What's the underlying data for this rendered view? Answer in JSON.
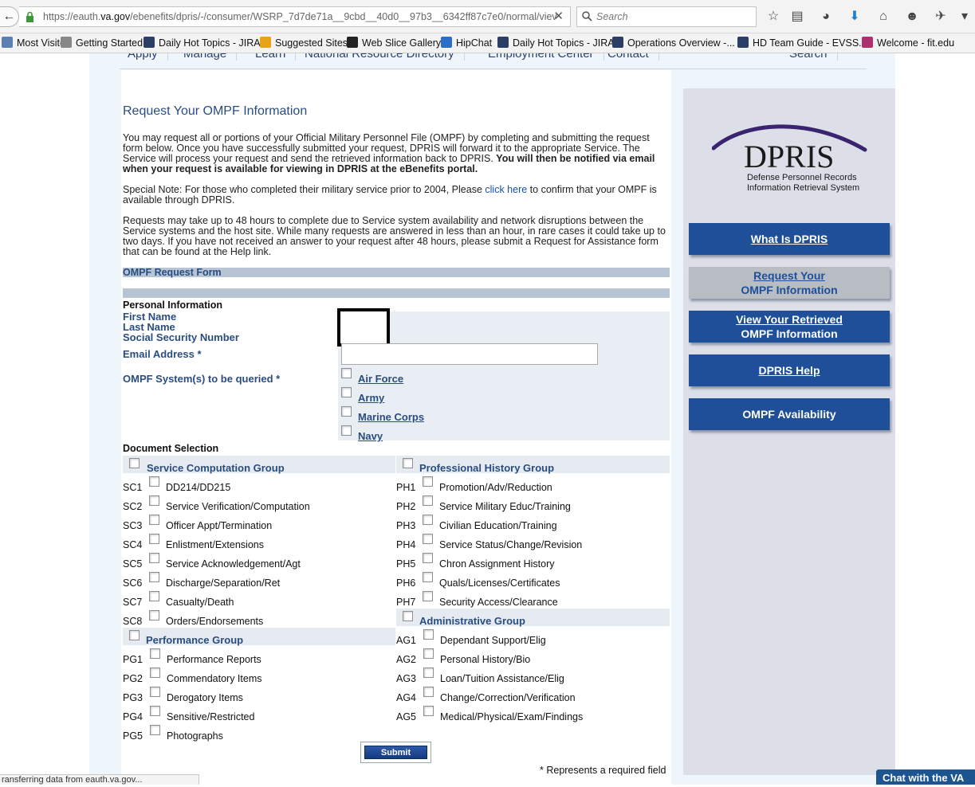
{
  "browser": {
    "url_prefix": "https://eauth.",
    "url_host": "va.gov",
    "url_rest": "/ebenefits/dpris/-/consumer/WSRP_7d7de71a__9cbd__40d0__97b3__6342ff87c7e0/normal/viev",
    "search_placeholder": "Search",
    "bookmarks": [
      {
        "label": "Most Visited",
        "icon_color": "#5a7fb0"
      },
      {
        "label": "Getting Started",
        "icon_color": "#888888"
      },
      {
        "label": "Daily Hot Topics - JIRA",
        "icon_color": "#2c3e66"
      },
      {
        "label": "Suggested Sites",
        "icon_color": "#e8a317"
      },
      {
        "label": "Web Slice Gallery",
        "icon_color": "#222222"
      },
      {
        "label": "HipChat",
        "icon_color": "#2a6fc9"
      },
      {
        "label": "Daily Hot Topics - JIRA",
        "icon_color": "#2c3e66"
      },
      {
        "label": "Operations Overview -...",
        "icon_color": "#2c3e66"
      },
      {
        "label": "HD Team Guide - EVSS...",
        "icon_color": "#2c3e66"
      },
      {
        "label": "Welcome - fit.edu",
        "icon_color": "#b0306e"
      }
    ]
  },
  "topnav": [
    "Apply",
    "Manage",
    "Learn",
    "National Resource Directory",
    "Employment Center",
    "Contact",
    "Search"
  ],
  "title": "Request Your OMPF Information",
  "intro": {
    "p1_plain": "You may request all or portions of your Official Military Personnel File (OMPF) by completing and submitting the request form below. Once you have successfully submitted your request, DPRIS will forward it to the appropriate Service. The Service will process your request and send the retrieved information back to DPRIS.",
    "p1_bold": "You will then be notified via email when your request is available for viewing in DPRIS at the eBenefits portal.",
    "p2_before": "Special Note: For those who completed their military service prior to 2004, Please",
    "p2_link": "click here",
    "p2_after": "to confirm that your OMPF is available through DPRIS.",
    "p3": "Requests may take up to 48 hours to complete due to Service system availability and network disruptions between the Service systems and the host site. While many requests are answered in less than an hour, in rare cases it could take up to two days. If you have not received an answer to your request after 48 hours, please submit a Request for Assistance form that can be found at the Help link."
  },
  "form": {
    "bar_label": "OMPF Request Form",
    "personal_info_label": "Personal Information",
    "first_name_label": "First Name",
    "last_name_label": "Last Name",
    "ssn_label": "Social Security Number",
    "email_label": "Email Address *",
    "email_value": "",
    "systems_label": "OMPF System(s) to be queried *",
    "systems": [
      "Air Force",
      "Army",
      "Marine Corps",
      "Navy"
    ],
    "document_selection_label": "Document Selection",
    "groups": {
      "service_computation": {
        "label": "Service Computation Group",
        "items": [
          {
            "code": "SC1",
            "label": "DD214/DD215"
          },
          {
            "code": "SC2",
            "label": "Service Verification/Computation"
          },
          {
            "code": "SC3",
            "label": "Officer Appt/Termination"
          },
          {
            "code": "SC4",
            "label": "Enlistment/Extensions"
          },
          {
            "code": "SC5",
            "label": "Service Acknowledgement/Agt"
          },
          {
            "code": "SC6",
            "label": "Discharge/Separation/Ret"
          },
          {
            "code": "SC7",
            "label": "Casualty/Death"
          },
          {
            "code": "SC8",
            "label": "Orders/Endorsements"
          }
        ]
      },
      "performance": {
        "label": "Performance Group",
        "items": [
          {
            "code": "PG1",
            "label": "Performance Reports"
          },
          {
            "code": "PG2",
            "label": "Commendatory Items"
          },
          {
            "code": "PG3",
            "label": "Derogatory Items"
          },
          {
            "code": "PG4",
            "label": "Sensitive/Restricted"
          },
          {
            "code": "PG5",
            "label": "Photographs"
          }
        ]
      },
      "professional_history": {
        "label": "Professional History Group",
        "items": [
          {
            "code": "PH1",
            "label": "Promotion/Adv/Reduction"
          },
          {
            "code": "PH2",
            "label": "Service Military Educ/Training"
          },
          {
            "code": "PH3",
            "label": "Civilian Education/Training"
          },
          {
            "code": "PH4",
            "label": "Service Status/Change/Revision"
          },
          {
            "code": "PH5",
            "label": "Chron Assignment History"
          },
          {
            "code": "PH6",
            "label": "Quals/Licenses/Certificates"
          },
          {
            "code": "PH7",
            "label": "Security Access/Clearance"
          }
        ]
      },
      "administrative": {
        "label": "Administrative Group",
        "items": [
          {
            "code": "AG1",
            "label": "Dependant Support/Elig"
          },
          {
            "code": "AG2",
            "label": "Personal History/Bio"
          },
          {
            "code": "AG3",
            "label": "Loan/Tuition Assistance/Elig"
          },
          {
            "code": "AG4",
            "label": "Change/Correction/Verification"
          },
          {
            "code": "AG5",
            "label": "Medical/Physical/Exam/Findings"
          }
        ]
      }
    },
    "submit_label": "Submit",
    "required_note": "* Represents a required field"
  },
  "sidebar": {
    "logo_text": "DPRIS",
    "logo_sub1": "Defense Personnel Records",
    "logo_sub2": "Information Retrieval System",
    "buttons": [
      {
        "line1": "What Is DPRIS",
        "line2": ""
      },
      {
        "line1": "Request Your",
        "line2": "OMPF Information"
      },
      {
        "line1": "View Your Retrieved",
        "line2": "OMPF Information"
      },
      {
        "line1": "DPRIS Help",
        "line2": ""
      },
      {
        "line1": "OMPF Availability",
        "line2": ""
      }
    ]
  },
  "status_text": "ransferring data from eauth.va.gov...",
  "chat_label": "Chat with the VA"
}
